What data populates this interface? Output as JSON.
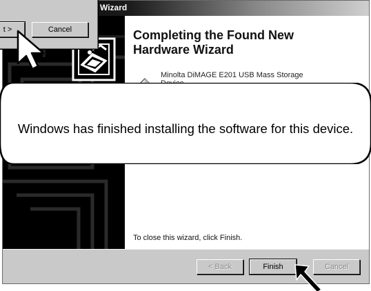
{
  "back_dialog": {
    "next_button_label": "t >",
    "cancel_button_label": "Cancel"
  },
  "wizard": {
    "title": "Wizard",
    "heading_line1": "Completing the Found New",
    "heading_line2": "Hardware Wizard",
    "device_line1": "Minolta DiMAGE E201 USB Mass Storage",
    "device_line2": "Device",
    "callout": "Windows has finished installing the software for this device.",
    "close_hint": "To close this wizard, click Finish.",
    "buttons": {
      "back": "< Back",
      "finish": "Finish",
      "cancel": "Cancel"
    }
  },
  "icons": {
    "hardware_icon": "hardware-install-icon",
    "device_icon": "device-diamond-icon",
    "cursor": "arrow-cursor-icon"
  },
  "colors": {
    "window_face": "#c9c9c9",
    "title_bar_start": "#000000",
    "title_bar_end": "#cfcfcf",
    "left_panel": "#000000"
  }
}
